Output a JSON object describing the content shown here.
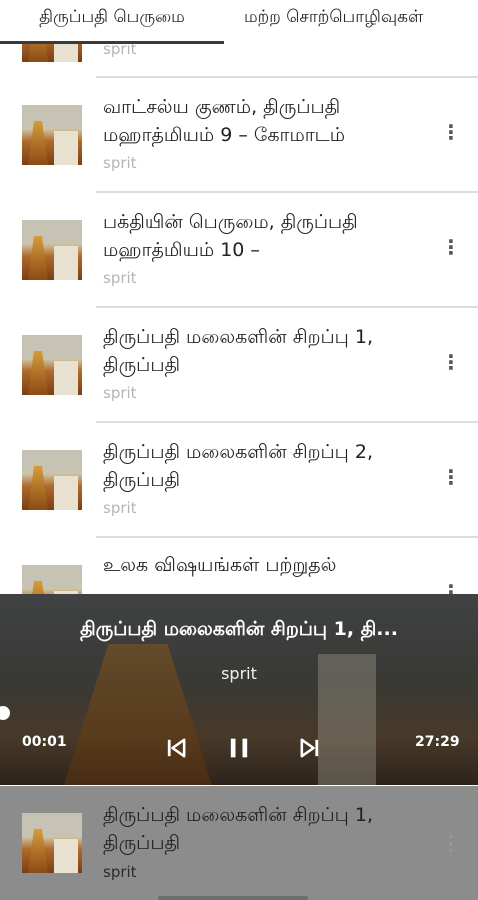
{
  "tabs": [
    {
      "label": "திருப்பதி பெருமை"
    },
    {
      "label": "மற்ற சொற்பொழிவுகள்"
    }
  ],
  "list": [
    {
      "title": "",
      "subtitle": "sprit"
    },
    {
      "title": "வாட்சல்ய குணம், திருப்பதி மஹாத்மியம் 9 – கோமாடம்",
      "subtitle": "sprit",
      "menu_icon": "more-vert-icon"
    },
    {
      "title": "பக்தியின் பெருமை, திருப்பதி மஹாத்மியம் 10 –",
      "subtitle": "sprit",
      "menu_icon": "more-vert-icon"
    },
    {
      "title": "திருப்பதி மலைகளின் சிறப்பு 1, திருப்பதி",
      "subtitle": "sprit",
      "menu_icon": "more-vert-icon"
    },
    {
      "title": "திருப்பதி மலைகளின் சிறப்பு 2, திருப்பதி",
      "subtitle": "sprit",
      "menu_icon": "more-vert-icon"
    },
    {
      "title": "உலக விஷயங்கள் பற்றுதல்",
      "subtitle": "",
      "menu_icon": "more-vert-icon"
    }
  ],
  "player": {
    "title": "திருப்பதி மலைகளின் சிறப்பு 1, தி...",
    "artist": "sprit",
    "current_time": "00:01",
    "duration": "27:29",
    "progress": 0.0006,
    "icons": [
      "skip-previous-icon",
      "pause-icon",
      "skip-next-icon"
    ]
  },
  "mini_player": {
    "title": "திருப்பதி மலைகளின் சிறப்பு 1, திருப்பதி",
    "subtitle": "sprit"
  }
}
